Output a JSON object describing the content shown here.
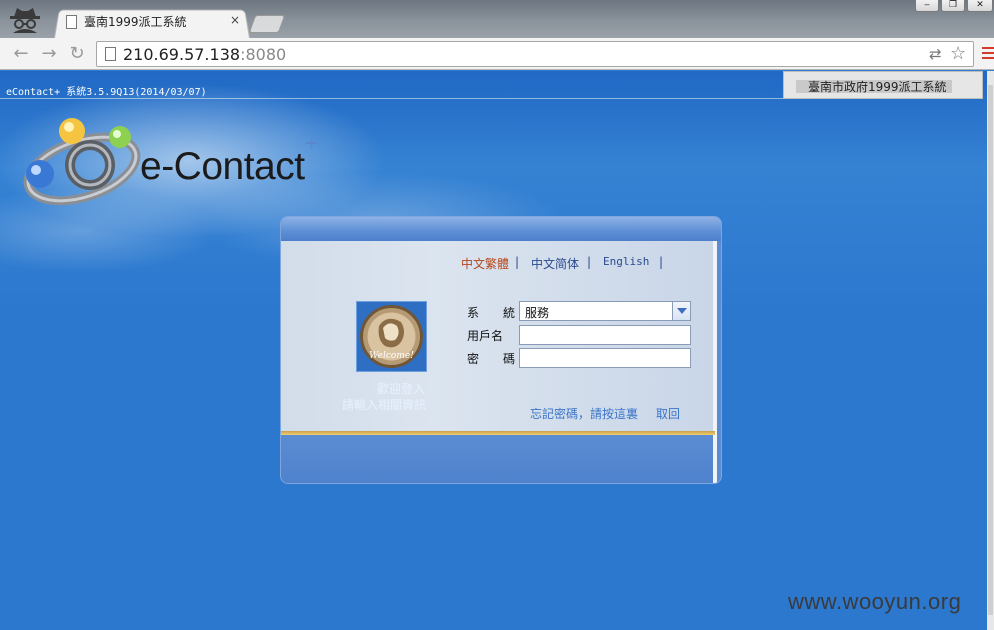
{
  "browser": {
    "tab_title": "臺南1999派工系統",
    "tab_close": "×",
    "url_host": "210.69.57.138",
    "url_port": ":8080",
    "window_controls": [
      "minimize-icon",
      "restore-icon",
      "close-icon"
    ],
    "window_glyphs": {
      "minimize": "‒",
      "restore": "❐",
      "close": "✕"
    },
    "nav_glyphs": {
      "back": "←",
      "forward": "→",
      "reload": "↻"
    },
    "omnibox_icons": {
      "translate": "⇄",
      "star": "☆"
    }
  },
  "header": {
    "version": "eContact+ 系統3.5.9Q13(2014/03/07)",
    "system_name": "臺南市政府1999派工系統"
  },
  "logo": {
    "text": "e-Contact",
    "plus": "+"
  },
  "login": {
    "languages": [
      {
        "label": "中文繁體",
        "color": "#b5461a"
      },
      {
        "label": "中文简体",
        "color": "#2a4a8f"
      },
      {
        "label": "English",
        "color": "#2a4a8f"
      }
    ],
    "separator": "|",
    "avatar_caption": "Welcome!",
    "welcome_line1": "歡迎登入",
    "welcome_line2": "請輸入相關資訊",
    "system_label": "系　　統",
    "system_value": "服務",
    "username_label": "用戶名",
    "password_label": "密　　碼",
    "username_value": "",
    "password_value": "",
    "forgot_link": "忘記密碼，請按這裏",
    "cancel_link": "取回"
  },
  "watermark": "www.wooyun.org",
  "colors": {
    "page_bg": "#2c78cf",
    "panel_body": "#d2ddea",
    "gold_line": "#e0b95a",
    "link": "#3a74c9"
  }
}
